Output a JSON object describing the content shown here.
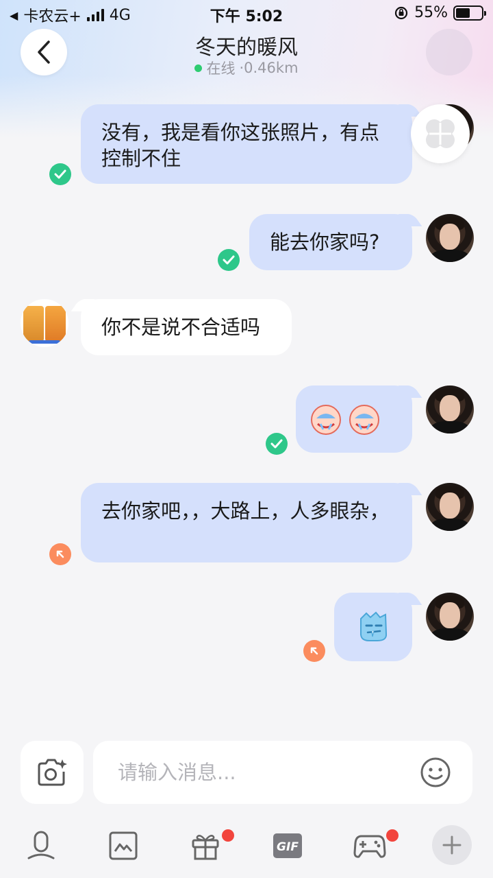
{
  "status_bar": {
    "carrier": "卡农云+",
    "network": "4G",
    "time": "下午 5:02",
    "battery": "55%",
    "battery_level": 0.55
  },
  "header": {
    "title": "冬天的暖风",
    "online_status": "在线",
    "distance": "·0.46km"
  },
  "messages": [
    {
      "from": "me",
      "text": "没有，我是看你这张照片，有点控制不住",
      "status": "read"
    },
    {
      "from": "me",
      "text": "能去你家吗?",
      "status": "read"
    },
    {
      "from": "other",
      "text": "你不是说不合适吗"
    },
    {
      "from": "me",
      "type": "emoji",
      "emoji": [
        "facepalm-crying-emoji",
        "facepalm-crying-emoji"
      ],
      "status": "read"
    },
    {
      "from": "me",
      "text": "去你家吧，，大路上，人多眼杂，",
      "status": "sent"
    },
    {
      "from": "me",
      "type": "emoji",
      "emoji": [
        "frozen-face-emoji"
      ],
      "status": "sent"
    }
  ],
  "input": {
    "placeholder": "请输入消息..."
  },
  "toolbar": {
    "items": [
      {
        "icon": "mic-icon",
        "badge": false
      },
      {
        "icon": "image-icon",
        "badge": false
      },
      {
        "icon": "gift-icon",
        "badge": true
      },
      {
        "icon": "gif-icon",
        "label": "GIF",
        "badge": false
      },
      {
        "icon": "gamepad-icon",
        "badge": true
      },
      {
        "icon": "plus-icon",
        "badge": false
      }
    ]
  },
  "colors": {
    "my_bubble": "#d5e0fc",
    "other_bubble": "#ffffff",
    "read_check": "#2ec78a",
    "sent_indicator": "#fb8c5e",
    "online_dot": "#2ecc71",
    "badge": "#f2453d"
  }
}
